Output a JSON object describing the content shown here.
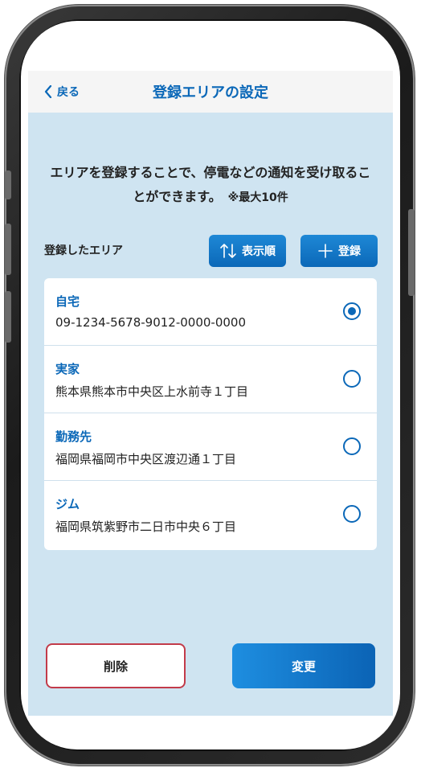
{
  "header": {
    "back_label": "戻る",
    "title": "登録エリアの設定"
  },
  "description": {
    "text": "エリアを登録することで、停電などの通知を受け取ることができます。",
    "note": "※最大10件"
  },
  "toolbar": {
    "section_label": "登録したエリア",
    "order_label": "表示順",
    "add_label": "登録"
  },
  "areas": [
    {
      "name": "自宅",
      "address": "09-1234-5678-9012-0000-0000",
      "selected": true
    },
    {
      "name": "実家",
      "address": "熊本県熊本市中央区上水前寺１丁目",
      "selected": false
    },
    {
      "name": "勤務先",
      "address": "福岡県福岡市中央区渡辺通１丁目",
      "selected": false
    },
    {
      "name": "ジム",
      "address": "福岡県筑紫野市二日市中央６丁目",
      "selected": false
    }
  ],
  "actions": {
    "delete_label": "削除",
    "change_label": "変更"
  },
  "colors": {
    "accent": "#0b68b8",
    "background": "#cfe4f1",
    "delete_border": "#c23b4a"
  }
}
